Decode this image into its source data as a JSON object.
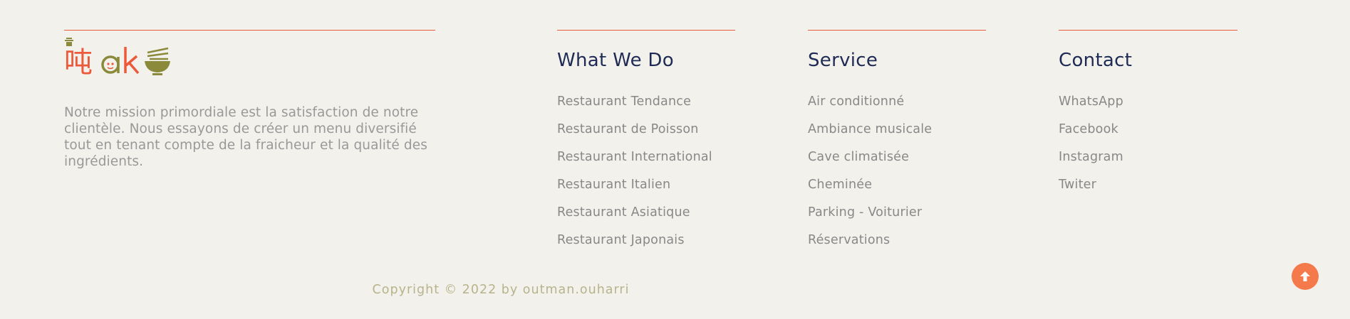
{
  "brand": {
    "logo_text": "吨ak",
    "mission": "Notre mission primordiale est la satisfaction de notre clientèle. Nous essayons de créer un menu diversifié tout en tenant compte de la fraicheur et la qualité des ingrédients."
  },
  "columns": [
    {
      "heading": "What We Do",
      "items": [
        "Restaurant Tendance",
        "Restaurant de Poisson",
        "Restaurant International",
        "Restaurant Italien",
        "Restaurant Asiatique",
        "Restaurant Japonais"
      ]
    },
    {
      "heading": "Service",
      "items": [
        "Air conditionné",
        "Ambiance musicale",
        "Cave climatisée",
        "Cheminée",
        "Parking - Voiturier",
        "Réservations"
      ]
    },
    {
      "heading": "Contact",
      "items": [
        "WhatsApp",
        "Facebook",
        "Instagram",
        "Twiter"
      ]
    }
  ],
  "footer": {
    "copyright": "Copyright © 2022 by outman.ouharri"
  },
  "colors": {
    "accent": "#ec5a3c",
    "heading": "#1f2a55",
    "logo_green": "#8a8a3a",
    "scroll_button": "#f47a4b"
  },
  "icons": {
    "scroll_top": "arrow-up-icon"
  }
}
